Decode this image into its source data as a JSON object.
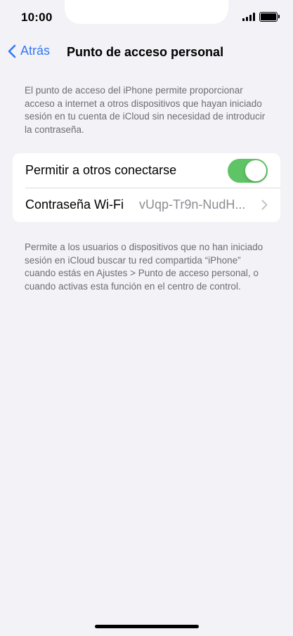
{
  "status_bar": {
    "time": "10:00"
  },
  "nav": {
    "back_label": "Atrás",
    "title": "Punto de acceso personal"
  },
  "top_description": "El punto de acceso del iPhone permite proporcionar acceso a internet a otros dispositivos que hayan iniciado sesión en tu cuenta de iCloud sin necesidad de introducir la contraseña.",
  "settings": {
    "allow_others_label": "Permitir a otros conectarse",
    "allow_others_on": true,
    "wifi_password_label": "Contraseña Wi-Fi",
    "wifi_password_value": "vUqp-Tr9n-NudH..."
  },
  "bottom_description": "Permite a los usuarios o dispositivos que no han iniciado sesión en iCloud buscar tu red compartida “iPhone” cuando estás en Ajustes > Punto de acceso personal, o cuando activas esta función en el centro de control.",
  "colors": {
    "accent": "#3478f6",
    "toggle_on": "#5ec465",
    "background": "#f2f2f7"
  }
}
